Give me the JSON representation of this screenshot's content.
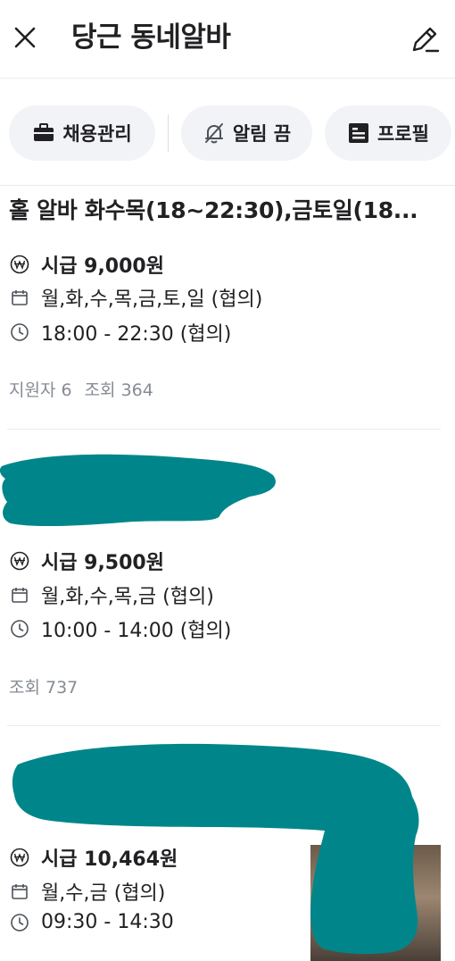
{
  "header": {
    "title": "당근 동네알바",
    "close_icon": "close-icon",
    "edit_icon": "pencil-icon"
  },
  "chips": [
    {
      "label": "채용관리",
      "icon": "briefcase-icon"
    },
    {
      "label": "알림 끔",
      "icon": "bell-off-icon"
    },
    {
      "label": "프로필",
      "icon": "profile-card-icon"
    }
  ],
  "jobs": [
    {
      "title": "홀 알바 화수목(18~22:30),금토일(18...",
      "wage": "시급 9,000원",
      "days": "월,화,수,목,금,토,일 (협의)",
      "hours": "18:00 - 22:30 (협의)",
      "applicants": "지원자 6",
      "views": "조회 364"
    },
    {
      "title": "",
      "wage": "시급 9,500원",
      "days": "월,화,수,목,금 (협의)",
      "hours": "10:00 - 14:00 (협의)",
      "views": "조회 737"
    },
    {
      "title": "",
      "wage": "시급 10,464원",
      "days": "월,수,금 (협의)",
      "hours": "09:30 - 14:30"
    }
  ],
  "colors": {
    "redaction": "#00868a",
    "chip_bg": "#f2f3f6",
    "muted_text": "#868b94"
  }
}
